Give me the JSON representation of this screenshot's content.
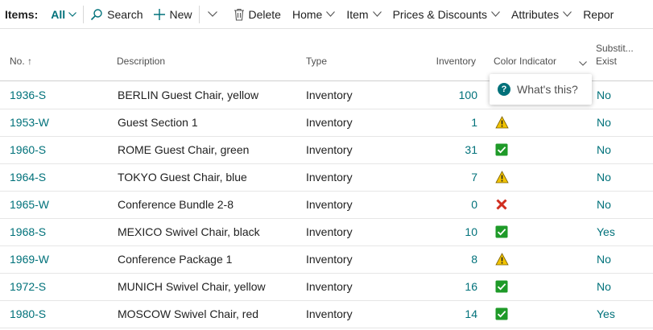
{
  "toolbar": {
    "items_label": "Items:",
    "filter_value": "All",
    "search_label": "Search",
    "new_label": "New",
    "delete_label": "Delete",
    "menus": [
      "Home",
      "Item",
      "Prices & Discounts",
      "Attributes",
      "Repor"
    ]
  },
  "columns": {
    "no": "No. ↑",
    "description": "Description",
    "type": "Type",
    "inventory": "Inventory",
    "color_indicator": "Color Indicator",
    "substitutes_line1": "Substit...",
    "substitutes_line2": "Exist"
  },
  "popup": {
    "text": "What's this?"
  },
  "rows": [
    {
      "no": "1936-S",
      "description": "BERLIN Guest Chair, yellow",
      "type": "Inventory",
      "inventory": "100",
      "indicator": "none",
      "subst": "No"
    },
    {
      "no": "1953-W",
      "description": "Guest Section 1",
      "type": "Inventory",
      "inventory": "1",
      "indicator": "warning",
      "subst": "No"
    },
    {
      "no": "1960-S",
      "description": "ROME Guest Chair, green",
      "type": "Inventory",
      "inventory": "31",
      "indicator": "ok",
      "subst": "No"
    },
    {
      "no": "1964-S",
      "description": "TOKYO Guest Chair, blue",
      "type": "Inventory",
      "inventory": "7",
      "indicator": "warning",
      "subst": "No"
    },
    {
      "no": "1965-W",
      "description": "Conference Bundle 2-8",
      "type": "Inventory",
      "inventory": "0",
      "indicator": "error",
      "subst": "No"
    },
    {
      "no": "1968-S",
      "description": "MEXICO Swivel Chair, black",
      "type": "Inventory",
      "inventory": "10",
      "indicator": "ok",
      "subst": "Yes"
    },
    {
      "no": "1969-W",
      "description": "Conference Package 1",
      "type": "Inventory",
      "inventory": "8",
      "indicator": "warning",
      "subst": "No"
    },
    {
      "no": "1972-S",
      "description": "MUNICH Swivel Chair, yellow",
      "type": "Inventory",
      "inventory": "16",
      "indicator": "ok",
      "subst": "No"
    },
    {
      "no": "1980-S",
      "description": "MOSCOW Swivel Chair, red",
      "type": "Inventory",
      "inventory": "14",
      "indicator": "ok",
      "subst": "Yes"
    }
  ],
  "colors": {
    "accent": "#00717a",
    "ok": "#1e9a28",
    "warning": "#f2c300",
    "error": "#d02d1f"
  }
}
